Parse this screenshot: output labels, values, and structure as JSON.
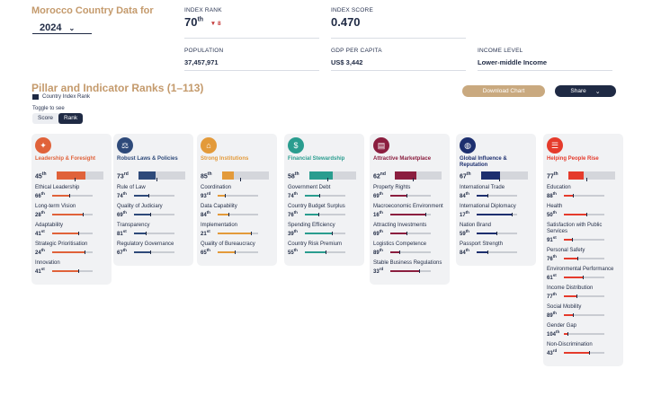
{
  "header": {
    "title": "Morocco Country Data for",
    "year": "2024"
  },
  "stats": {
    "index_rank": {
      "label": "INDEX RANK",
      "value": "70",
      "suffix": "th",
      "delta": "8"
    },
    "index_score": {
      "label": "INDEX SCORE",
      "value": "0.470"
    },
    "population": {
      "label": "POPULATION",
      "value": "37,457,971"
    },
    "gdp": {
      "label": "GDP PER CAPITA",
      "value": "US$ 3,442"
    },
    "income": {
      "label": "INCOME LEVEL",
      "value": "Lower-middle Income"
    }
  },
  "section": {
    "title": "Pillar and Indicator Ranks (1–113)",
    "legend": "Country Index Rank",
    "toggle_label": "Toggle to see",
    "toggle_score": "Score",
    "toggle_rank": "Rank",
    "download": "Download Chart",
    "share": "Share"
  },
  "colors": {
    "navy": "#1f2a44",
    "gold": "#c49a6c"
  },
  "pillars": [
    {
      "title": "Leadership & Foresight",
      "color": "#e0623a",
      "icon": "lightbulb-icon",
      "glyph": "✦",
      "rank": "45",
      "suffix": "th",
      "indicators": [
        {
          "name": "Ethical Leadership",
          "rank": "66",
          "suffix": "th"
        },
        {
          "name": "Long-term Vision",
          "rank": "28",
          "suffix": "th"
        },
        {
          "name": "Adaptability",
          "rank": "41",
          "suffix": "st"
        },
        {
          "name": "Strategic Prioritisation",
          "rank": "24",
          "suffix": "th"
        },
        {
          "name": "Innovation",
          "rank": "41",
          "suffix": "st"
        }
      ]
    },
    {
      "title": "Robust Laws & Policies",
      "color": "#2e4a7a",
      "icon": "scales-icon",
      "glyph": "⚖",
      "rank": "73",
      "suffix": "rd",
      "indicators": [
        {
          "name": "Rule of Law",
          "rank": "74",
          "suffix": "th"
        },
        {
          "name": "Quality of Judiciary",
          "rank": "69",
          "suffix": "th"
        },
        {
          "name": "Transparency",
          "rank": "81",
          "suffix": "st"
        },
        {
          "name": "Regulatory Governance",
          "rank": "67",
          "suffix": "th"
        }
      ]
    },
    {
      "title": "Strong Institutions",
      "color": "#e39a3a",
      "icon": "institution-icon",
      "glyph": "⌂",
      "rank": "85",
      "suffix": "th",
      "indicators": [
        {
          "name": "Coordination",
          "rank": "93",
          "suffix": "rd"
        },
        {
          "name": "Data Capability",
          "rank": "84",
          "suffix": "th"
        },
        {
          "name": "Implementation",
          "rank": "21",
          "suffix": "st"
        },
        {
          "name": "Quality of Bureaucracy",
          "rank": "65",
          "suffix": "th"
        }
      ]
    },
    {
      "title": "Financial Stewardship",
      "color": "#2a9d8f",
      "icon": "magnifier-coin-icon",
      "glyph": "$",
      "rank": "58",
      "suffix": "th",
      "indicators": [
        {
          "name": "Government Debt",
          "rank": "74",
          "suffix": "th"
        },
        {
          "name": "Country Budget Surplus",
          "rank": "76",
          "suffix": "th"
        },
        {
          "name": "Spending Efficiency",
          "rank": "39",
          "suffix": "th"
        },
        {
          "name": "Country Risk Premium",
          "rank": "55",
          "suffix": "th"
        }
      ]
    },
    {
      "title": "Attractive Marketplace",
      "color": "#8b1e3f",
      "icon": "marketplace-icon",
      "glyph": "▤",
      "rank": "62",
      "suffix": "nd",
      "indicators": [
        {
          "name": "Property Rights",
          "rank": "69",
          "suffix": "th"
        },
        {
          "name": "Macroeconomic Environment",
          "rank": "16",
          "suffix": "th"
        },
        {
          "name": "Attracting Investments",
          "rank": "69",
          "suffix": "th"
        },
        {
          "name": "Logistics Competence",
          "rank": "89",
          "suffix": "th"
        },
        {
          "name": "Stable Business Regulations",
          "rank": "33",
          "suffix": "rd"
        }
      ]
    },
    {
      "title": "Global Influence & Reputation",
      "color": "#1d2f6f",
      "icon": "globe-icon",
      "glyph": "◍",
      "rank": "67",
      "suffix": "th",
      "indicators": [
        {
          "name": "International Trade",
          "rank": "84",
          "suffix": "th"
        },
        {
          "name": "International Diplomacy",
          "rank": "17",
          "suffix": "th"
        },
        {
          "name": "Nation Brand",
          "rank": "59",
          "suffix": "th"
        },
        {
          "name": "Passport Strength",
          "rank": "84",
          "suffix": "th"
        }
      ]
    },
    {
      "title": "Helping People Rise",
      "color": "#e53b2c",
      "icon": "ladder-icon",
      "glyph": "☰",
      "rank": "77",
      "suffix": "th",
      "indicators": [
        {
          "name": "Education",
          "rank": "88",
          "suffix": "th"
        },
        {
          "name": "Health",
          "rank": "50",
          "suffix": "th"
        },
        {
          "name": "Satisfaction with Public Services",
          "rank": "91",
          "suffix": "st"
        },
        {
          "name": "Personal Safety",
          "rank": "76",
          "suffix": "th"
        },
        {
          "name": "Environmental Performance",
          "rank": "61",
          "suffix": "st"
        },
        {
          "name": "Income Distribution",
          "rank": "77",
          "suffix": "th"
        },
        {
          "name": "Social Mobility",
          "rank": "89",
          "suffix": "th"
        },
        {
          "name": "Gender Gap",
          "rank": "104",
          "suffix": "th"
        },
        {
          "name": "Non-Discrimination",
          "rank": "43",
          "suffix": "rd"
        }
      ]
    }
  ]
}
